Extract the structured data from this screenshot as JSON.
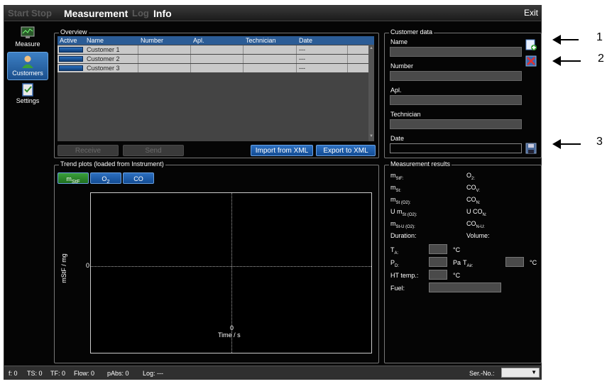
{
  "menu": {
    "start": "Start",
    "stop": "Stop",
    "measurement": "Measurement",
    "log": "Log",
    "info": "Info",
    "exit": "Exit"
  },
  "sidebar": {
    "items": [
      {
        "label": "Measure"
      },
      {
        "label": "Customers"
      },
      {
        "label": "Settings"
      }
    ]
  },
  "overview": {
    "title": "Overview",
    "columns": [
      "Active",
      "Name",
      "Number",
      "Apl.",
      "Technician",
      "Date"
    ],
    "rows": [
      {
        "name": "Customer 1",
        "number": "",
        "apl": "",
        "technician": "",
        "date": "---"
      },
      {
        "name": "Customer 2",
        "number": "",
        "apl": "",
        "technician": "",
        "date": "---"
      },
      {
        "name": "Customer 3",
        "number": "",
        "apl": "",
        "technician": "",
        "date": "---"
      }
    ],
    "buttons": {
      "receive": "Receive",
      "send": "Send",
      "import": "Import from XML",
      "export": "Export to XML"
    }
  },
  "trend": {
    "title": "Trend plots (loaded from Instrument)",
    "tabs": [
      "m",
      "O",
      "CO"
    ],
    "tab_subs": [
      "StF",
      "2",
      ""
    ],
    "ylabel": "mStF / mg",
    "xlabel": "Time / s",
    "ytick": "0",
    "xtick": "0"
  },
  "customer": {
    "title": "Customer data",
    "fields": [
      {
        "label": "Name",
        "value": ""
      },
      {
        "label": "Number",
        "value": ""
      },
      {
        "label": "Apl.",
        "value": ""
      },
      {
        "label": "Technician",
        "value": ""
      },
      {
        "label": "Date",
        "value": ""
      }
    ]
  },
  "results": {
    "title": "Measurement results",
    "left": [
      "m",
      "m",
      "m",
      "U m",
      "m",
      "Duration:"
    ],
    "left_subs": [
      "StF:",
      "St:",
      "St (O2):",
      "St (O2):",
      "St-U (O2):",
      ""
    ],
    "right": [
      "O",
      "CO",
      "CO",
      "U CO",
      "CO",
      "Volume:"
    ],
    "right_subs": [
      "2:",
      "V:",
      "N:",
      "N:",
      "N-U:",
      ""
    ],
    "ta_label": "T",
    "ta_sub": "A:",
    "ta_unit": "°C",
    "pd_label": "P",
    "pd_sub": "D:",
    "pd_unit": "Pa",
    "tair_label": "T",
    "tair_sub": "Air:",
    "tair_unit": "°C",
    "ht_label": "HT temp.:",
    "ht_unit": "°C",
    "fuel_label": "Fuel:"
  },
  "status": {
    "f": "f: 0",
    "ts": "TS: 0",
    "tf": "TF: 0",
    "flow": "Flow: 0",
    "pabs": "pAbs: 0",
    "log": "Log: ---",
    "ser": "Ser.-No.:"
  },
  "annotations": [
    "1",
    "2",
    "3"
  ],
  "colors": {
    "accent": "#1f5fae",
    "green": "#2e8b2e",
    "background": "#050505"
  }
}
